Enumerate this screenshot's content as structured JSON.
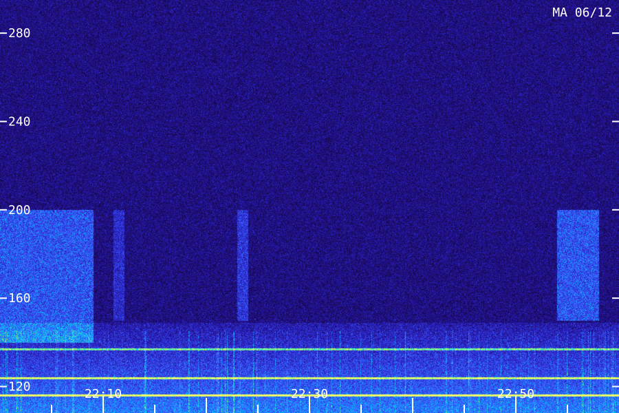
{
  "chart_data": {
    "type": "heatmap",
    "title": "MA 06/12",
    "y_axis": {
      "ticks": [
        280,
        240,
        200,
        160,
        120
      ],
      "range": [
        108,
        295
      ]
    },
    "x_axis": {
      "ticks": [
        "22:10",
        "22:30",
        "22:50"
      ]
    },
    "colormap": [
      "#000000",
      "#1a0a5e",
      "#2a1ec0",
      "#3a5cff",
      "#00c8ff",
      "#7dff7a",
      "#ffff60"
    ],
    "bands": [
      {
        "start": "22:00",
        "end": "22:09",
        "freq_min": 140,
        "freq_max": 200,
        "level": 0.35
      },
      {
        "start": "22:11",
        "end": "22:12",
        "freq_min": 150,
        "freq_max": 200,
        "level": 0.2
      },
      {
        "start": "22:23",
        "end": "22:24",
        "freq_min": 150,
        "freq_max": 200,
        "level": 0.25
      },
      {
        "start": "22:54",
        "end": "22:58",
        "freq_min": 150,
        "freq_max": 200,
        "level": 0.35
      }
    ],
    "lines": [
      {
        "freq": 137,
        "level": 0.55
      },
      {
        "freq": 124,
        "level": 0.65
      },
      {
        "freq": 116,
        "level": 0.7
      }
    ]
  }
}
